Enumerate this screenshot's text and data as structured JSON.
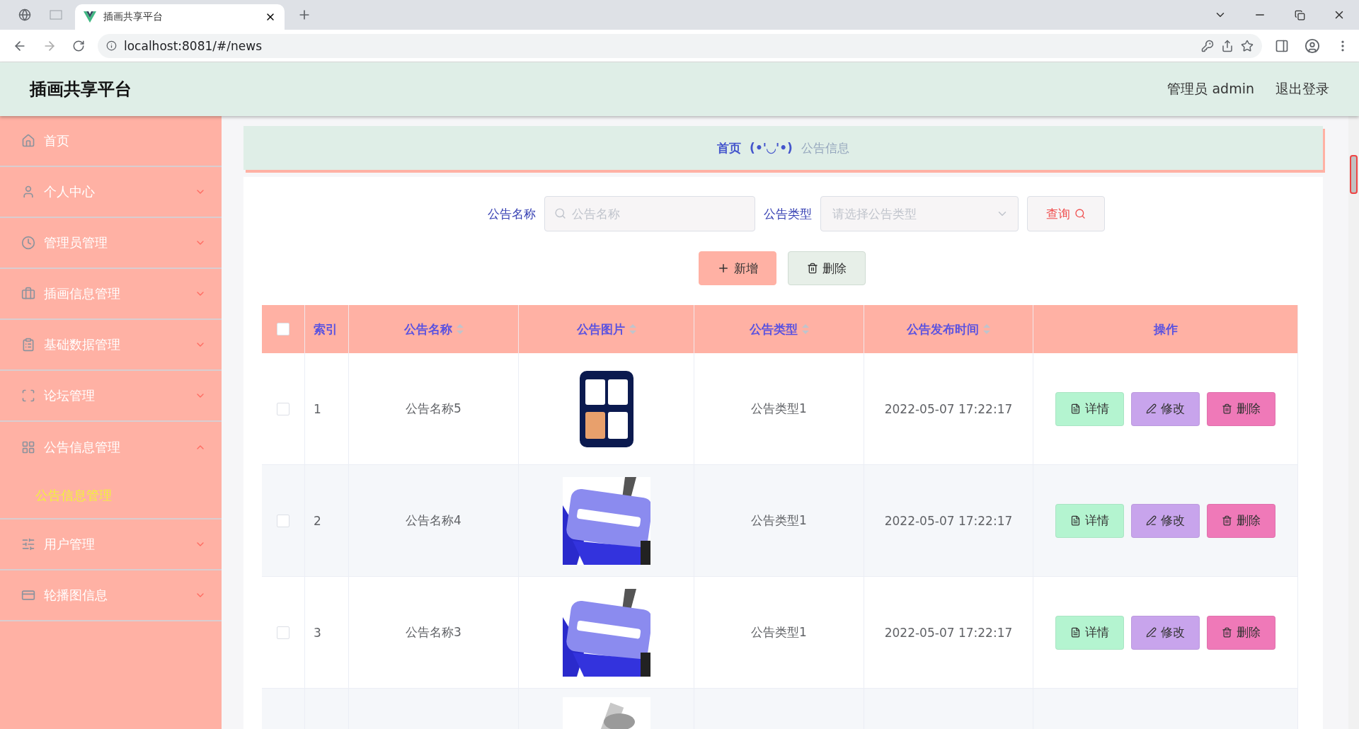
{
  "browser": {
    "tab_title": "插画共享平台",
    "url": "localhost:8081/#/news"
  },
  "header": {
    "title": "插画共享平台",
    "user": "管理员 admin",
    "logout": "退出登录"
  },
  "sidebar": {
    "items": [
      {
        "label": "首页",
        "expandable": false
      },
      {
        "label": "个人中心",
        "expandable": true,
        "expanded": false
      },
      {
        "label": "管理员管理",
        "expandable": true,
        "expanded": false
      },
      {
        "label": "插画信息管理",
        "expandable": true,
        "expanded": false
      },
      {
        "label": "基础数据管理",
        "expandable": true,
        "expanded": false
      },
      {
        "label": "论坛管理",
        "expandable": true,
        "expanded": false
      },
      {
        "label": "公告信息管理",
        "expandable": true,
        "expanded": true,
        "children": [
          {
            "label": "公告信息管理",
            "selected": true
          }
        ]
      },
      {
        "label": "用户管理",
        "expandable": true,
        "expanded": false
      },
      {
        "label": "轮播图信息",
        "expandable": true,
        "expanded": false
      }
    ]
  },
  "breadcrumb": {
    "home": "首页",
    "separator": "(•'◡'•)",
    "current": "公告信息"
  },
  "search": {
    "fields": [
      {
        "kind": "text",
        "label": "公告名称",
        "placeholder": "公告名称"
      },
      {
        "kind": "select",
        "label": "公告类型",
        "placeholder": "请选择公告类型"
      }
    ],
    "button": "查询"
  },
  "actions": [
    {
      "kind": "add",
      "label": "新增"
    },
    {
      "kind": "delete",
      "label": "删除"
    }
  ],
  "table": {
    "all_checked": false,
    "columns": [
      {
        "label": "索引",
        "sortable": false
      },
      {
        "label": "公告名称",
        "sortable": true
      },
      {
        "label": "公告图片",
        "sortable": true
      },
      {
        "label": "公告类型",
        "sortable": true
      },
      {
        "label": "公告发布时间",
        "sortable": true
      },
      {
        "label": "操作",
        "sortable": false
      }
    ],
    "rows": [
      {
        "checked": false,
        "index": "1",
        "name": "公告名称5",
        "image": {
          "kind": "picture"
        },
        "type": "公告类型1",
        "time": "2022-05-07 17:22:17",
        "buttons": [
          {
            "kind": "detail",
            "label": "详情"
          },
          {
            "kind": "edit",
            "label": "修改"
          },
          {
            "kind": "delete",
            "label": "删除"
          }
        ]
      },
      {
        "checked": false,
        "index": "2",
        "name": "公告名称4",
        "image": {
          "kind": "picture"
        },
        "type": "公告类型1",
        "time": "2022-05-07 17:22:17",
        "buttons": [
          {
            "kind": "detail",
            "label": "详情"
          },
          {
            "kind": "edit",
            "label": "修改"
          },
          {
            "kind": "delete",
            "label": "删除"
          }
        ]
      },
      {
        "checked": false,
        "index": "3",
        "name": "公告名称3",
        "image": {
          "kind": "picture"
        },
        "type": "公告类型1",
        "time": "2022-05-07 17:22:17",
        "buttons": [
          {
            "kind": "detail",
            "label": "详情"
          },
          {
            "kind": "edit",
            "label": "修改"
          },
          {
            "kind": "delete",
            "label": "删除"
          }
        ]
      },
      {
        "image": {
          "kind": "picture"
        }
      }
    ]
  }
}
